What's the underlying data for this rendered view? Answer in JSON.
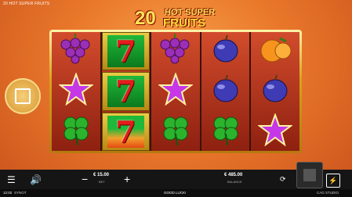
{
  "header": {
    "title": "20 HOT SUPER FRUITS"
  },
  "logo": {
    "num": "20",
    "hot": "HOT SUPER",
    "fruits": "FRUITS"
  },
  "reels": [
    [
      "grapes",
      "star",
      "clover"
    ],
    [
      "seven",
      "seven",
      "seven-fire"
    ],
    [
      "grapes",
      "star",
      "clover"
    ],
    [
      "plum",
      "plum",
      "clover"
    ],
    [
      "orange",
      "plum",
      "star"
    ]
  ],
  "symbols": {
    "seven": "7"
  },
  "controls": {
    "bet_value": "€ 15.00",
    "bet_label": "BET",
    "balance_value": "€ 485.00",
    "balance_label": "BALANCE",
    "turbo_label": "⚡"
  },
  "footer": {
    "time": "12:02",
    "brand": "SYNOT",
    "message": "GOOD LUCK!",
    "brand2": "CAG STUDIO"
  },
  "colors": {
    "accent": "#ffe45a",
    "frame": "#d9a21e"
  }
}
